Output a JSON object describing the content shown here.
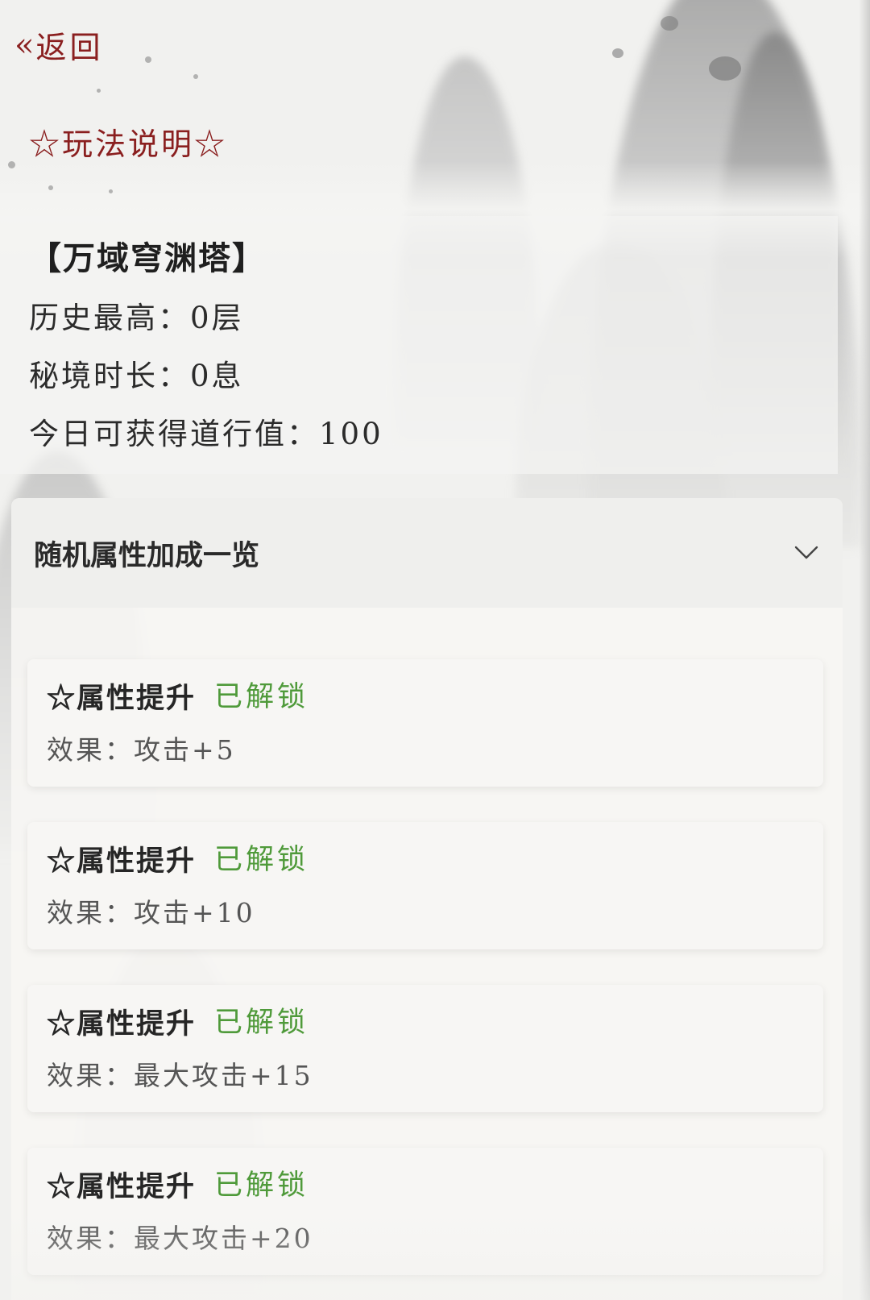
{
  "nav": {
    "back_icon": "double-chevron-left",
    "back_label": "返回"
  },
  "rules": {
    "title": "☆玩法说明☆"
  },
  "tower": {
    "name": "【万域穹渊塔】",
    "stats": [
      "历史最高：0层",
      "秘境时长：0息",
      "今日可获得道行值：100"
    ]
  },
  "bonus_panel": {
    "title": "随机属性加成一览",
    "toggle_icon": "chevron-down",
    "items": [
      {
        "title": "☆属性提升",
        "status": "已解锁",
        "effect": "效果：攻击+5"
      },
      {
        "title": "☆属性提升",
        "status": "已解锁",
        "effect": "效果：攻击+10"
      },
      {
        "title": "☆属性提升",
        "status": "已解锁",
        "effect": "效果：最大攻击+15"
      },
      {
        "title": "☆属性提升",
        "status": "已解锁",
        "effect": "效果：最大攻击+20"
      }
    ]
  },
  "colors": {
    "accent_red": "#8a1f1f",
    "unlocked_green": "#4f9a3a",
    "background": "#f1f1ef"
  }
}
